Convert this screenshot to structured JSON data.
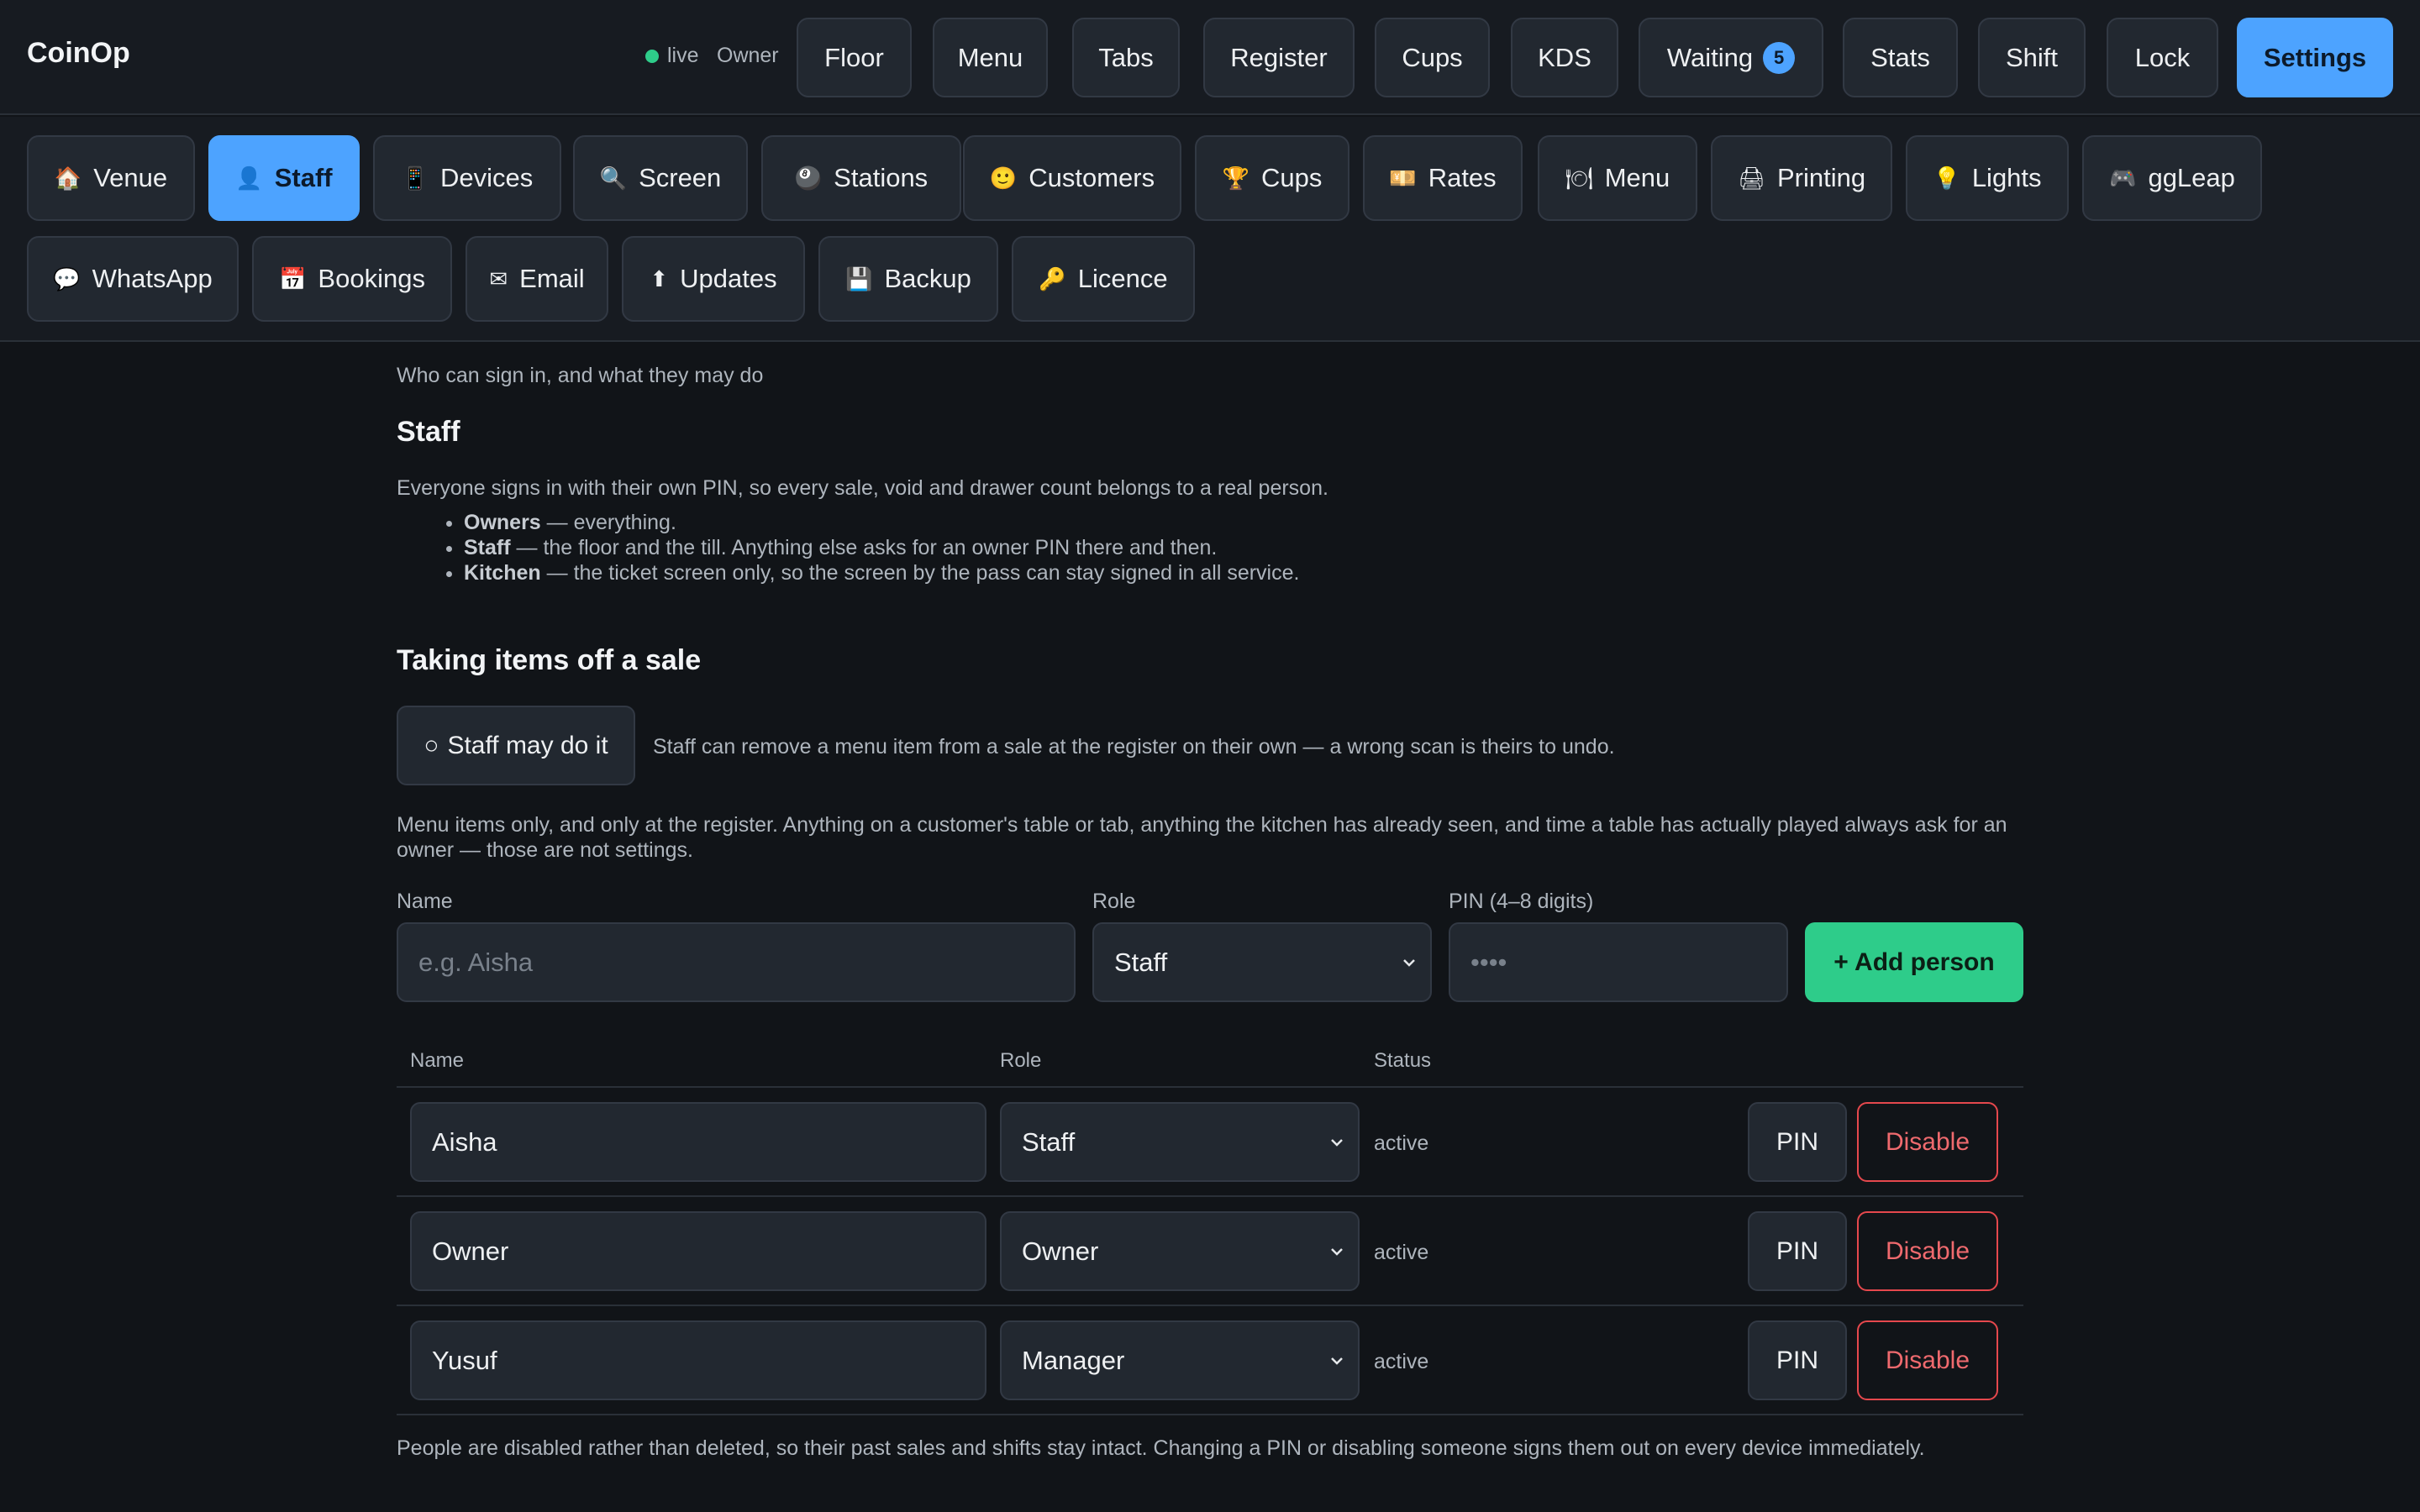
{
  "app": {
    "title": "CoinOp",
    "live_label": "live",
    "role_label": "Owner"
  },
  "nav": {
    "items": [
      {
        "label": "Floor"
      },
      {
        "label": "Menu"
      },
      {
        "label": "Tabs"
      },
      {
        "label": "Register"
      },
      {
        "label": "Cups"
      },
      {
        "label": "KDS"
      },
      {
        "label": "Waiting",
        "badge": "5"
      },
      {
        "label": "Stats"
      },
      {
        "label": "Shift"
      },
      {
        "label": "Lock"
      },
      {
        "label": "Settings",
        "active": true
      }
    ]
  },
  "settings_tabs": [
    {
      "icon": "🏠",
      "label": "Venue"
    },
    {
      "icon": "👤",
      "label": "Staff",
      "active": true
    },
    {
      "icon": "📱",
      "label": "Devices"
    },
    {
      "icon": "🔍",
      "label": "Screen"
    },
    {
      "icon": "🎱",
      "label": "Stations"
    },
    {
      "icon": "🙂",
      "label": "Customers"
    },
    {
      "icon": "🏆",
      "label": "Cups"
    },
    {
      "icon": "💴",
      "label": "Rates"
    },
    {
      "icon": "🍽",
      "label": "Menu"
    },
    {
      "icon": "🖨",
      "label": "Printing"
    },
    {
      "icon": "💡",
      "label": "Lights"
    },
    {
      "icon": "🎮",
      "label": "ggLeap"
    },
    {
      "icon": "💬",
      "label": "WhatsApp"
    },
    {
      "icon": "📅",
      "label": "Bookings"
    },
    {
      "icon": "✉",
      "label": "Email"
    },
    {
      "icon": "⬆",
      "label": "Updates"
    },
    {
      "icon": "💾",
      "label": "Backup"
    },
    {
      "icon": "🔑",
      "label": "Licence"
    }
  ],
  "staff_section": {
    "subtitle": "Who can sign in, and what they may do",
    "heading": "Staff",
    "intro": "Everyone signs in with their own PIN, so every sale, void and drawer count belongs to a real person.",
    "roles": [
      {
        "name": "Owners",
        "desc": " — everything."
      },
      {
        "name": "Staff",
        "desc": " — the floor and the till. Anything else asks for an owner PIN there and then."
      },
      {
        "name": "Kitchen",
        "desc": " — the ticket screen only, so the screen by the pass can stay signed in all service."
      }
    ]
  },
  "items_section": {
    "heading": "Taking items off a sale",
    "toggle_icon": "○",
    "toggle_label": "Staff may do it",
    "toggle_desc": "Staff can remove a menu item from a sale at the register on their own — a wrong scan is theirs to undo.",
    "note": "Menu items only, and only at the register. Anything on a customer's table or tab, anything the kitchen has already seen, and time a table has actually played always ask for an owner — those are not settings."
  },
  "add_form": {
    "name_label": "Name",
    "name_placeholder": "e.g. Aisha",
    "role_label": "Role",
    "role_value": "Staff",
    "pin_label": "PIN (4–8 digits)",
    "pin_placeholder": "••••",
    "add_button": "+ Add person"
  },
  "table": {
    "headers": {
      "name": "Name",
      "role": "Role",
      "status": "Status"
    },
    "rows": [
      {
        "name": "Aisha",
        "role": "Staff",
        "status": "active",
        "pin": "PIN",
        "disable": "Disable"
      },
      {
        "name": "Owner",
        "role": "Owner",
        "status": "active",
        "pin": "PIN",
        "disable": "Disable"
      },
      {
        "name": "Yusuf",
        "role": "Manager",
        "status": "active",
        "pin": "PIN",
        "disable": "Disable"
      }
    ]
  },
  "footer_note": "People are disabled rather than deleted, so their past sales and shifts stay intact. Changing a PIN or disabling someone signs them out on every device immediately.",
  "colors": {
    "accent": "#4da3ff",
    "success": "#2ecc8a",
    "danger": "#e5484d",
    "background": "#111418"
  }
}
